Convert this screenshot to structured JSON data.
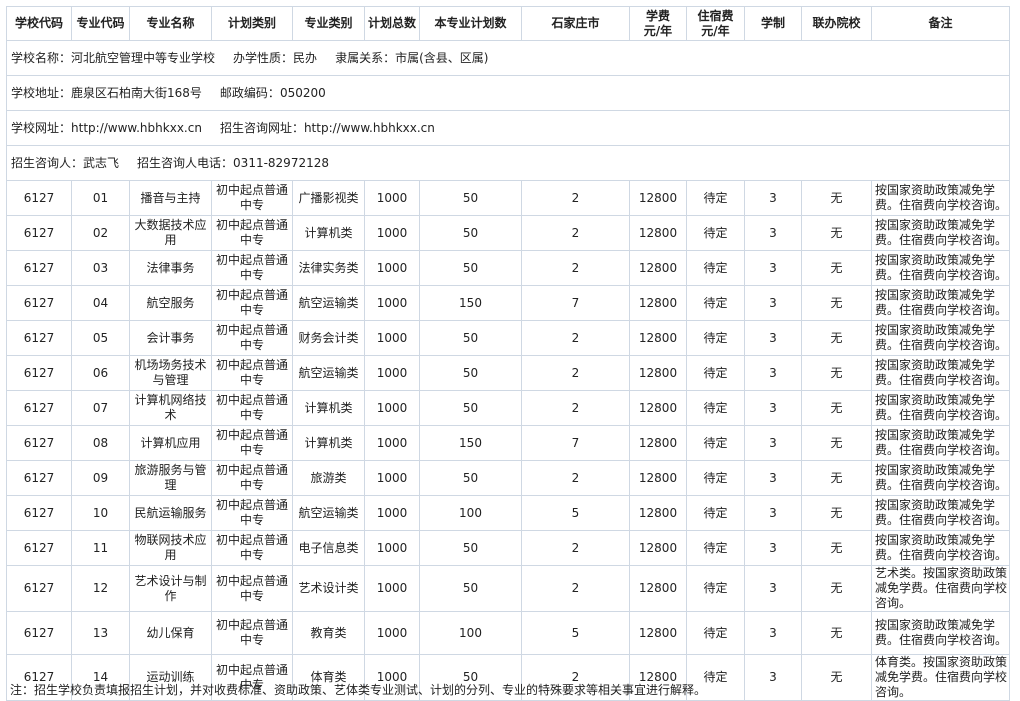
{
  "school": {
    "name_label": "学校名称：",
    "name": "河北航空管理中等专业学校",
    "nature_label": "办学性质：",
    "nature": "民办",
    "affiliation_label": "隶属关系：",
    "affiliation": "市属(含县、区属)",
    "address_label": "学校地址：",
    "address": "鹿泉区石柏南大街168号",
    "postcode_label": "邮政编码：",
    "postcode": "050200",
    "website_label": "学校网址：",
    "website": "http://www.hbhkxx.cn",
    "consult_site_label": "招生咨询网址：",
    "consult_site": "http://www.hbhkxx.cn",
    "contact_label": "招生咨询人：",
    "contact": "武志飞",
    "phone_label": "招生咨询人电话：",
    "phone": "0311-82972128"
  },
  "headers": [
    "学校代码",
    "专业代码",
    "专业名称",
    "计划类别",
    "专业类别",
    "计划总数",
    "本专业计划数",
    "石家庄市",
    "学费\n元/年",
    "住宿费\n元/年",
    "学制",
    "联办院校",
    "备注"
  ],
  "rows": [
    {
      "school_code": "6127",
      "major_code": "01",
      "major": "播音与主持",
      "plan_type": "初中起点普通中专",
      "category": "广播影视类",
      "total": "1000",
      "major_plan": "50",
      "sjz": "2",
      "tuition": "12800",
      "dorm": "待定",
      "years": "3",
      "partner": "无",
      "note": "按国家资助政策减免学费。住宿费向学校咨询。"
    },
    {
      "school_code": "6127",
      "major_code": "02",
      "major": "大数据技术应用",
      "plan_type": "初中起点普通中专",
      "category": "计算机类",
      "total": "1000",
      "major_plan": "50",
      "sjz": "2",
      "tuition": "12800",
      "dorm": "待定",
      "years": "3",
      "partner": "无",
      "note": "按国家资助政策减免学费。住宿费向学校咨询。"
    },
    {
      "school_code": "6127",
      "major_code": "03",
      "major": "法律事务",
      "plan_type": "初中起点普通中专",
      "category": "法律实务类",
      "total": "1000",
      "major_plan": "50",
      "sjz": "2",
      "tuition": "12800",
      "dorm": "待定",
      "years": "3",
      "partner": "无",
      "note": "按国家资助政策减免学费。住宿费向学校咨询。"
    },
    {
      "school_code": "6127",
      "major_code": "04",
      "major": "航空服务",
      "plan_type": "初中起点普通中专",
      "category": "航空运输类",
      "total": "1000",
      "major_plan": "150",
      "sjz": "7",
      "tuition": "12800",
      "dorm": "待定",
      "years": "3",
      "partner": "无",
      "note": "按国家资助政策减免学费。住宿费向学校咨询。"
    },
    {
      "school_code": "6127",
      "major_code": "05",
      "major": "会计事务",
      "plan_type": "初中起点普通中专",
      "category": "财务会计类",
      "total": "1000",
      "major_plan": "50",
      "sjz": "2",
      "tuition": "12800",
      "dorm": "待定",
      "years": "3",
      "partner": "无",
      "note": "按国家资助政策减免学费。住宿费向学校咨询。"
    },
    {
      "school_code": "6127",
      "major_code": "06",
      "major": "机场场务技术与管理",
      "plan_type": "初中起点普通中专",
      "category": "航空运输类",
      "total": "1000",
      "major_plan": "50",
      "sjz": "2",
      "tuition": "12800",
      "dorm": "待定",
      "years": "3",
      "partner": "无",
      "note": "按国家资助政策减免学费。住宿费向学校咨询。"
    },
    {
      "school_code": "6127",
      "major_code": "07",
      "major": "计算机网络技术",
      "plan_type": "初中起点普通中专",
      "category": "计算机类",
      "total": "1000",
      "major_plan": "50",
      "sjz": "2",
      "tuition": "12800",
      "dorm": "待定",
      "years": "3",
      "partner": "无",
      "note": "按国家资助政策减免学费。住宿费向学校咨询。"
    },
    {
      "school_code": "6127",
      "major_code": "08",
      "major": "计算机应用",
      "plan_type": "初中起点普通中专",
      "category": "计算机类",
      "total": "1000",
      "major_plan": "150",
      "sjz": "7",
      "tuition": "12800",
      "dorm": "待定",
      "years": "3",
      "partner": "无",
      "note": "按国家资助政策减免学费。住宿费向学校咨询。"
    },
    {
      "school_code": "6127",
      "major_code": "09",
      "major": "旅游服务与管理",
      "plan_type": "初中起点普通中专",
      "category": "旅游类",
      "total": "1000",
      "major_plan": "50",
      "sjz": "2",
      "tuition": "12800",
      "dorm": "待定",
      "years": "3",
      "partner": "无",
      "note": "按国家资助政策减免学费。住宿费向学校咨询。"
    },
    {
      "school_code": "6127",
      "major_code": "10",
      "major": "民航运输服务",
      "plan_type": "初中起点普通中专",
      "category": "航空运输类",
      "total": "1000",
      "major_plan": "100",
      "sjz": "5",
      "tuition": "12800",
      "dorm": "待定",
      "years": "3",
      "partner": "无",
      "note": "按国家资助政策减免学费。住宿费向学校咨询。"
    },
    {
      "school_code": "6127",
      "major_code": "11",
      "major": "物联网技术应用",
      "plan_type": "初中起点普通中专",
      "category": "电子信息类",
      "total": "1000",
      "major_plan": "50",
      "sjz": "2",
      "tuition": "12800",
      "dorm": "待定",
      "years": "3",
      "partner": "无",
      "note": "按国家资助政策减免学费。住宿费向学校咨询。"
    },
    {
      "school_code": "6127",
      "major_code": "12",
      "major": "艺术设计与制作",
      "plan_type": "初中起点普通中专",
      "category": "艺术设计类",
      "total": "1000",
      "major_plan": "50",
      "sjz": "2",
      "tuition": "12800",
      "dorm": "待定",
      "years": "3",
      "partner": "无",
      "note": "艺术类。按国家资助政策减免学费。住宿费向学校咨询。"
    },
    {
      "school_code": "6127",
      "major_code": "13",
      "major": "幼儿保育",
      "plan_type": "初中起点普通中专",
      "category": "教育类",
      "total": "1000",
      "major_plan": "100",
      "sjz": "5",
      "tuition": "12800",
      "dorm": "待定",
      "years": "3",
      "partner": "无",
      "note": "按国家资助政策减免学费。住宿费向学校咨询。"
    },
    {
      "school_code": "6127",
      "major_code": "14",
      "major": "运动训练",
      "plan_type": "初中起点普通中专",
      "category": "体育类",
      "total": "1000",
      "major_plan": "50",
      "sjz": "2",
      "tuition": "12800",
      "dorm": "待定",
      "years": "3",
      "partner": "无",
      "note": "体育类。按国家资助政策减免学费。住宿费向学校咨询。"
    }
  ],
  "footnote": "注：招生学校负责填报招生计划，并对收费标准、资助政策、艺体类专业测试、计划的分列、专业的特殊要求等相关事宜进行解释。"
}
